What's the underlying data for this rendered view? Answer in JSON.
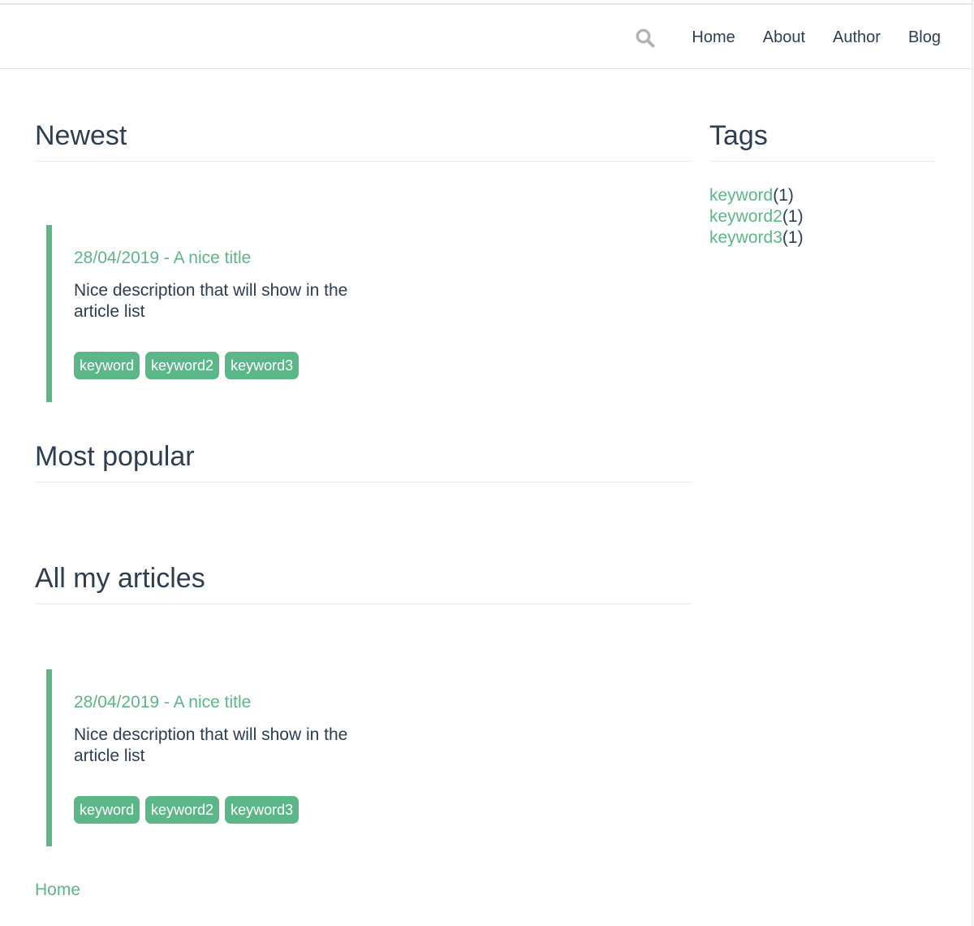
{
  "nav": {
    "search_icon": "search-icon",
    "items": [
      "Home",
      "About",
      "Author",
      "Blog"
    ]
  },
  "sections": {
    "newest": "Newest",
    "popular": "Most popular",
    "all": "All my articles"
  },
  "sidebar": {
    "title": "Tags",
    "tags": [
      {
        "name": "keyword",
        "count": "(1)"
      },
      {
        "name": "keyword2",
        "count": "(1)"
      },
      {
        "name": "keyword3",
        "count": "(1)"
      }
    ]
  },
  "articles": {
    "newest": {
      "title": "28/04/2019 - A nice title",
      "description": " Nice description that will show in the article list",
      "tags": [
        "keyword",
        "keyword2",
        "keyword3"
      ]
    },
    "all": {
      "title": "28/04/2019 - A nice title",
      "description": " Nice description that will show in the article list",
      "tags": [
        "keyword",
        "keyword2",
        "keyword3"
      ]
    }
  },
  "footer": {
    "home_link": "Home"
  },
  "colors": {
    "accent": "#5cb788",
    "text": "#2c3e50",
    "icon": "#b3b3b3"
  }
}
